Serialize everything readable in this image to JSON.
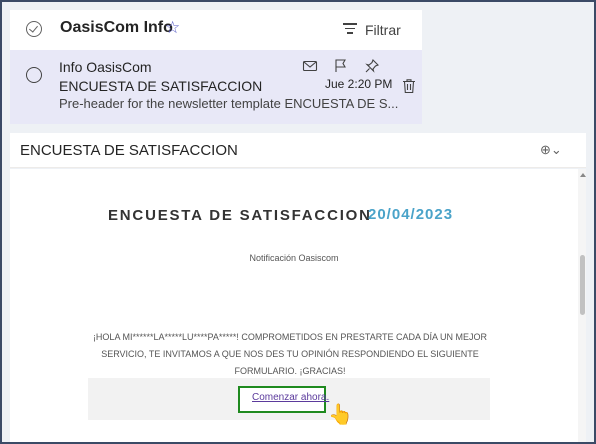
{
  "list": {
    "folder_title": "OasisCom Info",
    "filter_label": "Filtrar",
    "item": {
      "sender": "Info OasisCom",
      "subject": "ENCUESTA DE SATISFACCION",
      "time": "Jue 2:20 PM",
      "preview": "Pre-header for the newsletter template ENCUESTA DE S..."
    }
  },
  "reading": {
    "title": "ENCUESTA DE SATISFACCION",
    "email_title": "ENCUESTA DE SATISFACCION",
    "email_date": "20/04/2023",
    "notification": "Notificación Oasiscom",
    "message": "¡HOLA MI******LA*****LU****PA*****! COMPROMETIDOS EN PRESTARTE CADA DÍA UN MEJOR SERVICIO, TE INVITAMOS A QUE NOS DES TU OPINIÓN RESPONDIENDO EL SIGUIENTE FORMULARIO. ¡GRACIAS!",
    "cta_label": "Comenzar ahora."
  },
  "icons": {
    "select_all": "check-circle-icon",
    "favorite": "star-icon",
    "filter": "filter-icon",
    "unread": "envelope-icon",
    "flag": "flag-icon",
    "pin": "pin-icon",
    "delete": "trash-icon",
    "zoom": "zoom-icon"
  },
  "colors": {
    "accent": "#5b5fc7",
    "selected_row": "#e8e8f7",
    "date": "#4aa3c9",
    "highlight": "#1f8a1f",
    "link": "#5b3a9c"
  }
}
